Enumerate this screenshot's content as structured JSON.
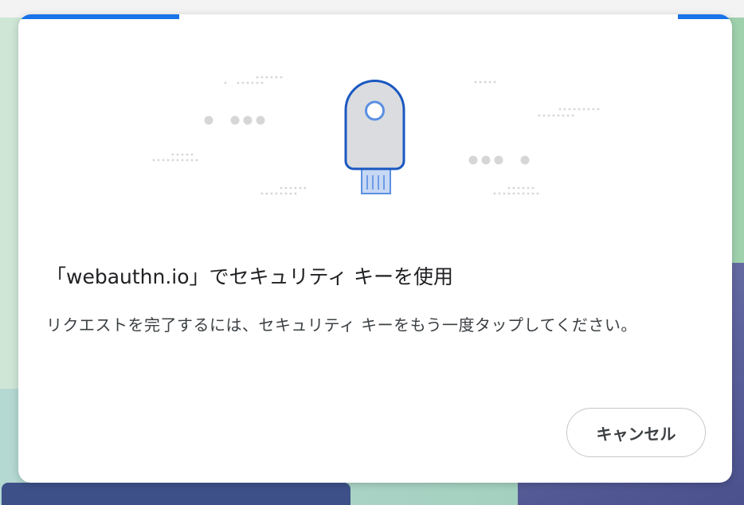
{
  "dialog": {
    "title": "「webauthn.io」でセキュリティ キーを使用",
    "message": "リクエストを完了するには、セキュリティ キーをもう一度タップしてください。",
    "cancel_label": "キャンセル",
    "illustration_icon": "security-key-icon",
    "accent_color": "#1a73e8",
    "key_body_color": "#dadce0",
    "key_outline_color": "#1a57c0"
  },
  "background": {
    "colors": {
      "green": "#bfe0c9",
      "purple": "#5a609a",
      "blue_card": "#3d5188"
    }
  }
}
